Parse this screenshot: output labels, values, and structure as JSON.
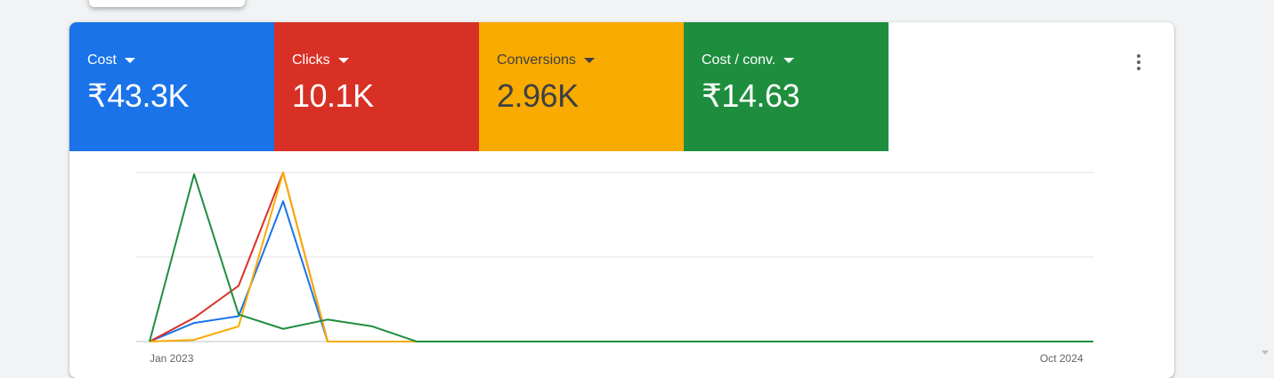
{
  "colors": {
    "cost": "#1a73e8",
    "clicks": "#d93025",
    "conversions": "#f9ab00",
    "cost_per_conv": "#1e8e3e"
  },
  "scorecards": [
    {
      "label": "Cost",
      "value": "₹43.3K"
    },
    {
      "label": "Clicks",
      "value": "10.1K"
    },
    {
      "label": "Conversions",
      "value": "2.96K"
    },
    {
      "label": "Cost / conv.",
      "value": "₹14.63"
    }
  ],
  "more_icon": "more-vert-icon",
  "chart_data": {
    "type": "line",
    "x_tick_labels": [
      "Jan 2023",
      "Oct 2024"
    ],
    "y_range": [
      0,
      1
    ],
    "grid": true,
    "series": [
      {
        "name": "Cost",
        "color": "#1a73e8",
        "values": [
          0,
          0.11,
          0.15,
          0.83,
          0,
          0,
          0,
          0,
          0,
          0,
          0,
          0,
          0,
          0,
          0,
          0,
          0,
          0,
          0,
          0,
          0,
          0
        ]
      },
      {
        "name": "Clicks",
        "color": "#d93025",
        "values": [
          0,
          0.14,
          0.33,
          1.0,
          0,
          0,
          0,
          0,
          0,
          0,
          0,
          0,
          0,
          0,
          0,
          0,
          0,
          0,
          0,
          0,
          0,
          0
        ]
      },
      {
        "name": "Conversions",
        "color": "#f9ab00",
        "values": [
          0,
          0.01,
          0.09,
          1.0,
          0,
          0,
          0,
          0,
          0,
          0,
          0,
          0,
          0,
          0,
          0,
          0,
          0,
          0,
          0,
          0,
          0,
          0
        ]
      },
      {
        "name": "Cost / conv.",
        "color": "#1e8e3e",
        "values": [
          0,
          0.99,
          0.16,
          0.075,
          0.13,
          0.09,
          0,
          0,
          0,
          0,
          0,
          0,
          0,
          0,
          0,
          0,
          0,
          0,
          0,
          0,
          0,
          0
        ]
      }
    ]
  }
}
